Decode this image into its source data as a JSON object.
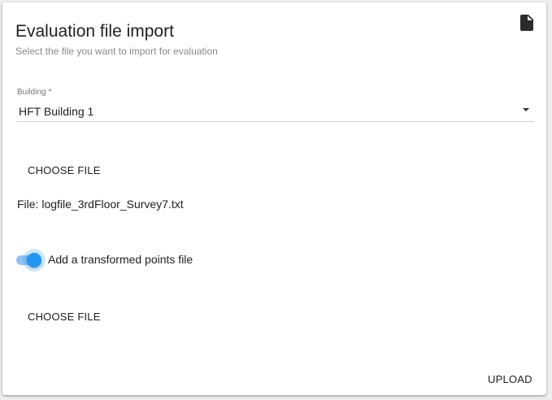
{
  "dialog": {
    "title": "Evaluation file import",
    "subtitle": "Select the file you want to import for evaluation",
    "header_icon": "document-icon"
  },
  "building_select": {
    "label": "Building *",
    "value": "HFT Building 1"
  },
  "log_file": {
    "choose_label": "CHOOSE FILE",
    "file_text": "File: logfile_3rdFloor_Survey7.txt"
  },
  "transformed_toggle": {
    "label": "Add a transformed points file",
    "checked": true,
    "accent_color": "#2196f3"
  },
  "transformed_file": {
    "choose_label": "CHOOSE FILE"
  },
  "actions": {
    "upload_label": "UPLOAD"
  }
}
